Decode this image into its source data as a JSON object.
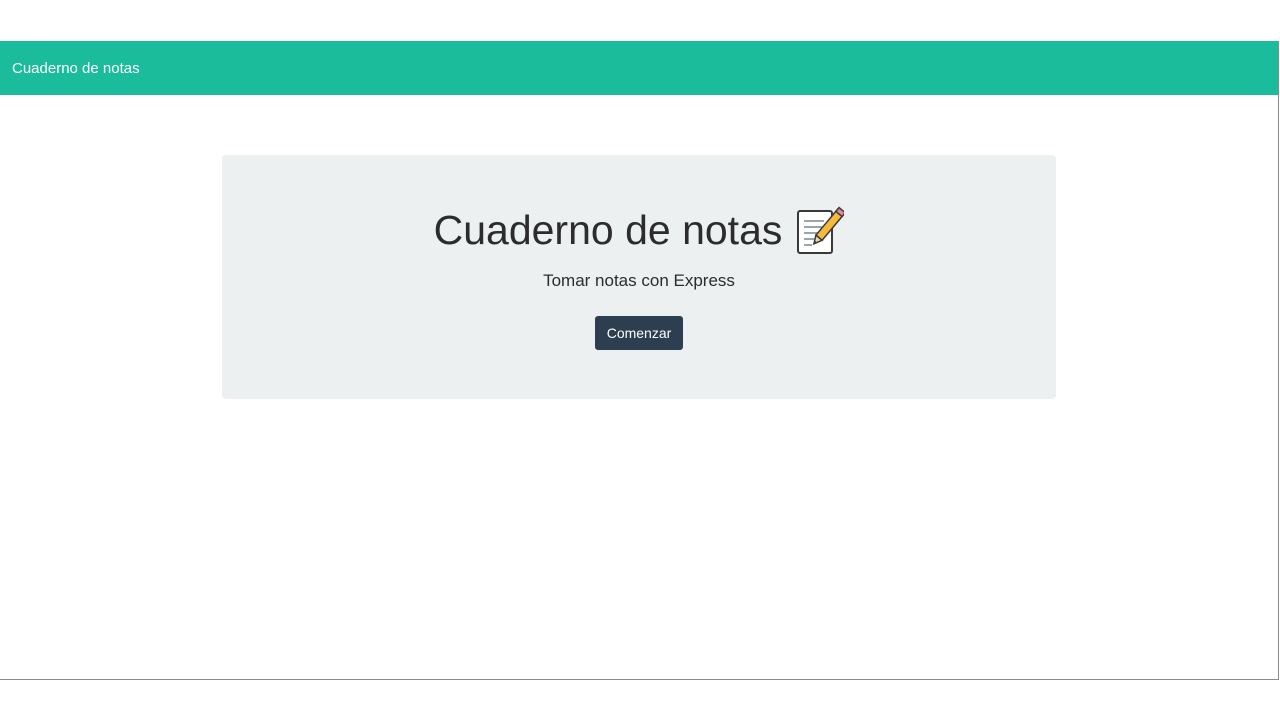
{
  "navbar": {
    "brand": "Cuaderno de notas"
  },
  "hero": {
    "title": "Cuaderno de notas",
    "icon": "memo-icon",
    "lead": "Tomar notas con Express",
    "button_label": "Comenzar"
  },
  "colors": {
    "navbar_bg": "#1abc9c",
    "jumbotron_bg": "#ecf0f1",
    "button_bg": "#2c3e50"
  }
}
